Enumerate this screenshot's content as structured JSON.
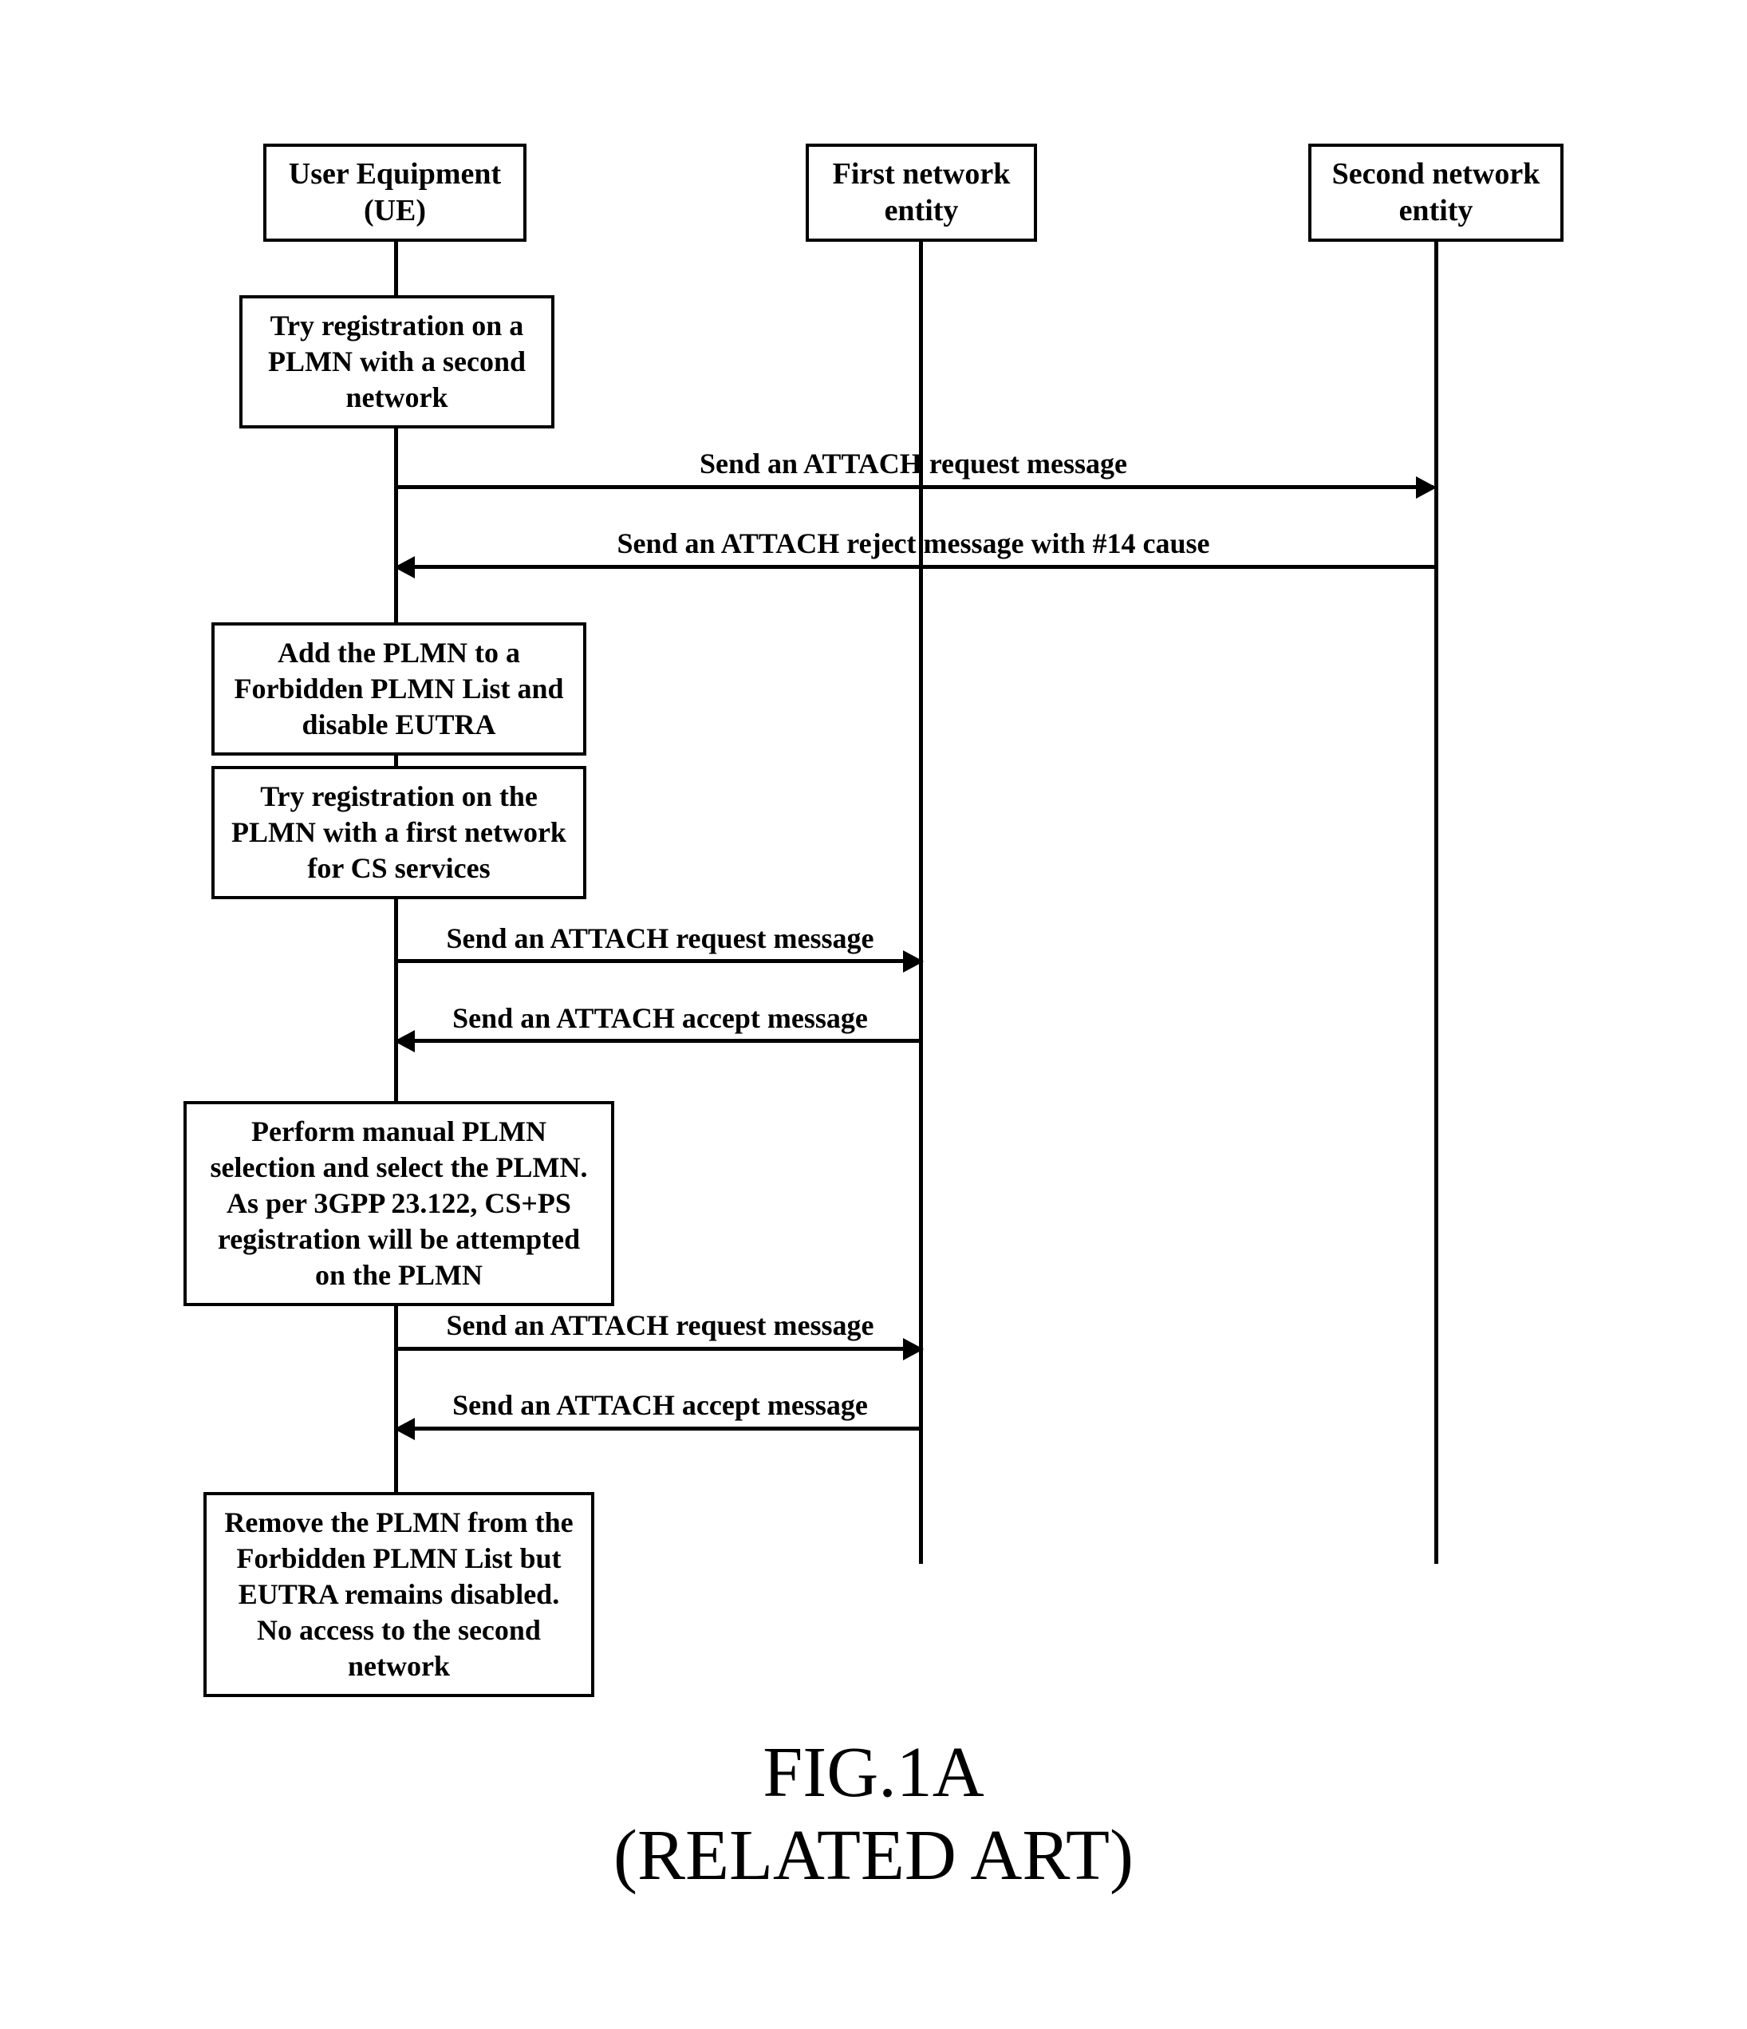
{
  "lifelines": {
    "ue": {
      "label_line1": "User Equipment",
      "label_line2": "(UE)"
    },
    "first": {
      "label_line1": "First network",
      "label_line2": "entity"
    },
    "second": {
      "label_line1": "Second network",
      "label_line2": "entity"
    }
  },
  "steps": {
    "s1": "Try registration on a PLMN with a second network",
    "s2": "Add the PLMN to a Forbidden PLMN List and disable EUTRA",
    "s3": "Try registration on the PLMN with a first network for CS services",
    "s4": "Perform manual PLMN selection and select  the PLMN. As per 3GPP 23.122, CS+PS registration will be attempted on the PLMN",
    "s5": "Remove the PLMN from the Forbidden PLMN List but EUTRA remains disabled. No access to the second network"
  },
  "messages": {
    "m1": "Send an ATTACH request message",
    "m2": "Send an ATTACH reject message with #14 cause",
    "m3": "Send an ATTACH request message",
    "m4": "Send an ATTACH accept message",
    "m5": "Send an ATTACH request message",
    "m6": "Send an ATTACH accept message"
  },
  "caption": {
    "line1": "FIG.1A",
    "line2": "(RELATED ART)"
  },
  "chart_data": {
    "type": "sequence-diagram",
    "actors": [
      "User Equipment (UE)",
      "First network entity",
      "Second network entity"
    ],
    "events": [
      {
        "type": "action",
        "actor": "User Equipment (UE)",
        "text": "Try registration on a PLMN with a second network"
      },
      {
        "type": "message",
        "from": "User Equipment (UE)",
        "to": "Second network entity",
        "text": "Send an ATTACH request message"
      },
      {
        "type": "message",
        "from": "Second network entity",
        "to": "User Equipment (UE)",
        "text": "Send an ATTACH reject message with #14 cause"
      },
      {
        "type": "action",
        "actor": "User Equipment (UE)",
        "text": "Add the PLMN to a Forbidden PLMN List and disable EUTRA"
      },
      {
        "type": "action",
        "actor": "User Equipment (UE)",
        "text": "Try registration on the PLMN with a first network for CS services"
      },
      {
        "type": "message",
        "from": "User Equipment (UE)",
        "to": "First network entity",
        "text": "Send an ATTACH request message"
      },
      {
        "type": "message",
        "from": "First network entity",
        "to": "User Equipment (UE)",
        "text": "Send an ATTACH accept message"
      },
      {
        "type": "action",
        "actor": "User Equipment (UE)",
        "text": "Perform manual PLMN selection and select the PLMN. As per 3GPP 23.122, CS+PS registration will be attempted on the PLMN"
      },
      {
        "type": "message",
        "from": "User Equipment (UE)",
        "to": "First network entity",
        "text": "Send an ATTACH request message"
      },
      {
        "type": "message",
        "from": "First network entity",
        "to": "User Equipment (UE)",
        "text": "Send an ATTACH accept message"
      },
      {
        "type": "action",
        "actor": "User Equipment (UE)",
        "text": "Remove the PLMN from the Forbidden PLMN List but EUTRA remains disabled. No access to the second network"
      }
    ]
  }
}
